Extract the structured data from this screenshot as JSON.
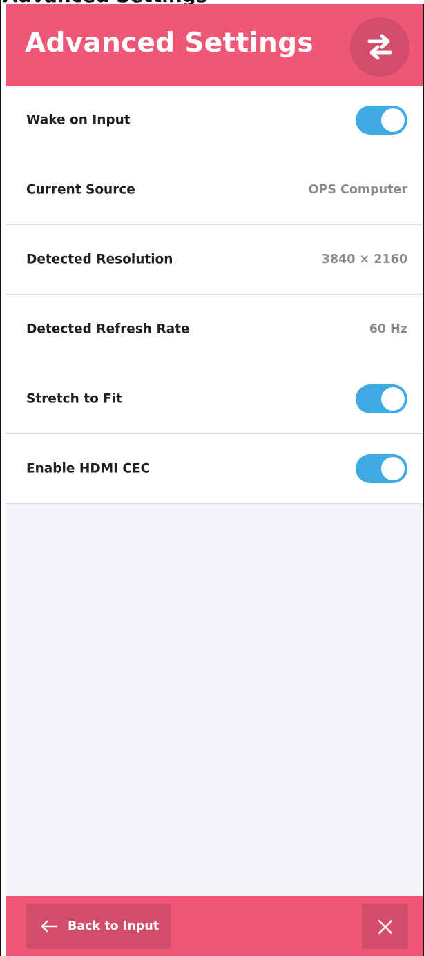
{
  "header": {
    "title": "Advanced Settings",
    "swap_icon": "swap-arrows-icon",
    "background_color": "#ef5777",
    "button_color": "#d24d69"
  },
  "settings": [
    {
      "label": "Wake on Input",
      "type": "toggle",
      "enabled": true
    },
    {
      "label": "Current Source",
      "type": "value",
      "value": "OPS Computer"
    },
    {
      "label": "Detected Resolution",
      "type": "value",
      "value": "3840 × 2160"
    },
    {
      "label": "Detected Refresh Rate",
      "type": "value",
      "value": "60 Hz"
    },
    {
      "label": "Stretch to Fit",
      "type": "toggle",
      "enabled": true
    },
    {
      "label": "Enable HDMI CEC",
      "type": "toggle",
      "enabled": true
    }
  ],
  "toggle_color": "#3ea9e3",
  "footer": {
    "back_label": "Back to Input",
    "back_icon": "arrow-left-icon",
    "close_icon": "close-icon"
  }
}
